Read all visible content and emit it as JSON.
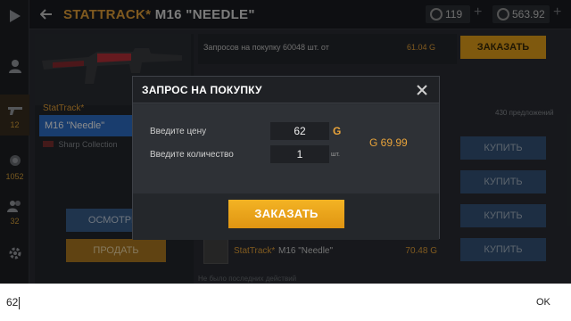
{
  "header": {
    "stattrack": "STATTRACK*",
    "weapon_title": "M16 \"NEEDLE\"",
    "currency_gold": "119",
    "currency_silver": "563.92"
  },
  "sidebar": {
    "items": [
      {
        "icon": "play-icon",
        "count": ""
      },
      {
        "icon": "profile-icon",
        "count": ""
      },
      {
        "icon": "pistol-icon",
        "count": "12"
      },
      {
        "icon": "case-icon",
        "count": "1052"
      },
      {
        "icon": "players-icon",
        "count": "32"
      },
      {
        "icon": "gear-icon",
        "count": ""
      }
    ]
  },
  "item_panel": {
    "stattrack_label": "StatTrack*",
    "name": "M16 \"Needle\"",
    "collection": "Sharp Collection",
    "inspect_label": "ОСМОТРЕТ",
    "sell_label": "ПРОДАТЬ"
  },
  "market": {
    "request_text": "Запросов на покупку 60048 шт. от",
    "request_price": "61.04 G",
    "order_label": "ЗАКАЗАТЬ",
    "offers_count": "430 предложений",
    "buy_label": "КУПИТЬ",
    "listing_stattrack": "StatTrack*",
    "listing_name": "M16 \"Needle\"",
    "listing_price": "70.48 G",
    "history_text": "Не было последних действий"
  },
  "modal": {
    "title": "ЗАПРОС НА ПОКУПКУ",
    "price_label": "Введите цену",
    "price_value": "62",
    "price_unit": "G",
    "qty_label": "Введите количество",
    "qty_value": "1",
    "qty_unit": "шт.",
    "total": "G 69.99",
    "submit_label": "ЗАКАЗАТЬ"
  },
  "ime": {
    "text": "62",
    "ok_label": "OK"
  },
  "colors": {
    "accent": "#e8a33a",
    "buy_button": "#35557a",
    "order_button": "#f0a91d"
  }
}
